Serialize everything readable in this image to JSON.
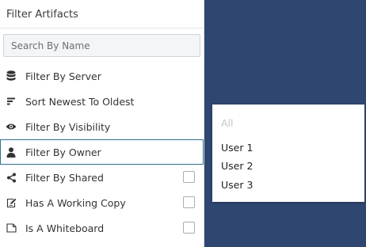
{
  "panel": {
    "title": "Filter Artifacts",
    "search_placeholder": "Search By Name"
  },
  "menu": {
    "items": [
      {
        "label": "Filter By Server",
        "icon": "database-icon"
      },
      {
        "label": "Sort Newest To Oldest",
        "icon": "sort-lines-icon"
      },
      {
        "label": "Filter By Visibility",
        "icon": "eye-icon"
      },
      {
        "label": "Filter By Owner",
        "icon": "person-icon",
        "active": true
      },
      {
        "label": "Filter By Shared",
        "icon": "share-icon",
        "checked": false
      },
      {
        "label": "Has A Working Copy",
        "icon": "edit-document-icon",
        "checked": false
      },
      {
        "label": "Is A Whiteboard",
        "icon": "page-icon",
        "checked": false
      }
    ]
  },
  "owner_dropdown": {
    "placeholder": "All",
    "options": [
      "User 1",
      "User 2",
      "User 3"
    ]
  },
  "colors": {
    "background": "#2f4670",
    "active_border": "#2f6f8e"
  }
}
